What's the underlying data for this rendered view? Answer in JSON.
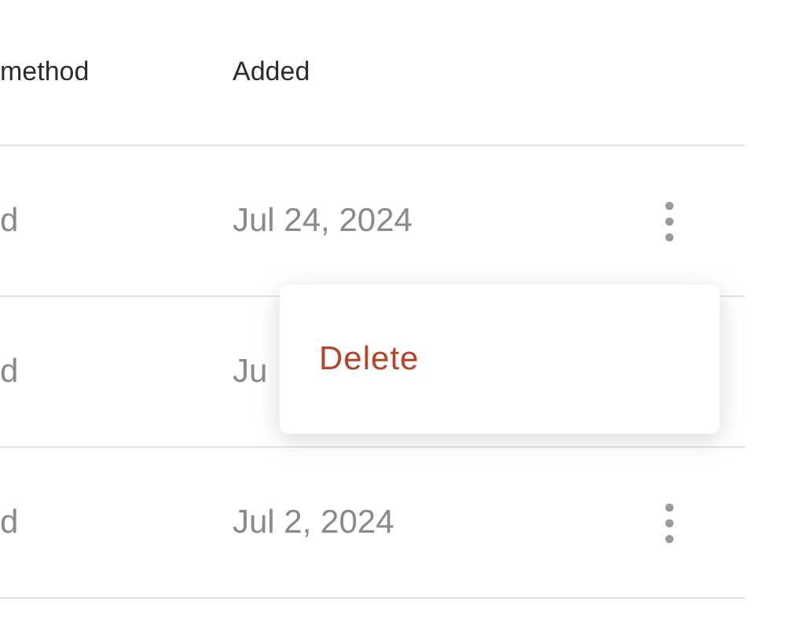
{
  "table": {
    "columns": [
      {
        "label": "method"
      },
      {
        "label": "Added"
      }
    ],
    "rows": [
      {
        "cells": [
          "d",
          "Jul 24, 2024"
        ],
        "menu_button": true
      },
      {
        "cells": [
          "d",
          "Ju"
        ],
        "menu_button": false
      },
      {
        "cells": [
          "d",
          "Jul 2, 2024"
        ],
        "menu_button": true
      }
    ]
  },
  "context_menu": {
    "items": [
      {
        "label": "Delete",
        "kind": "danger"
      }
    ]
  }
}
